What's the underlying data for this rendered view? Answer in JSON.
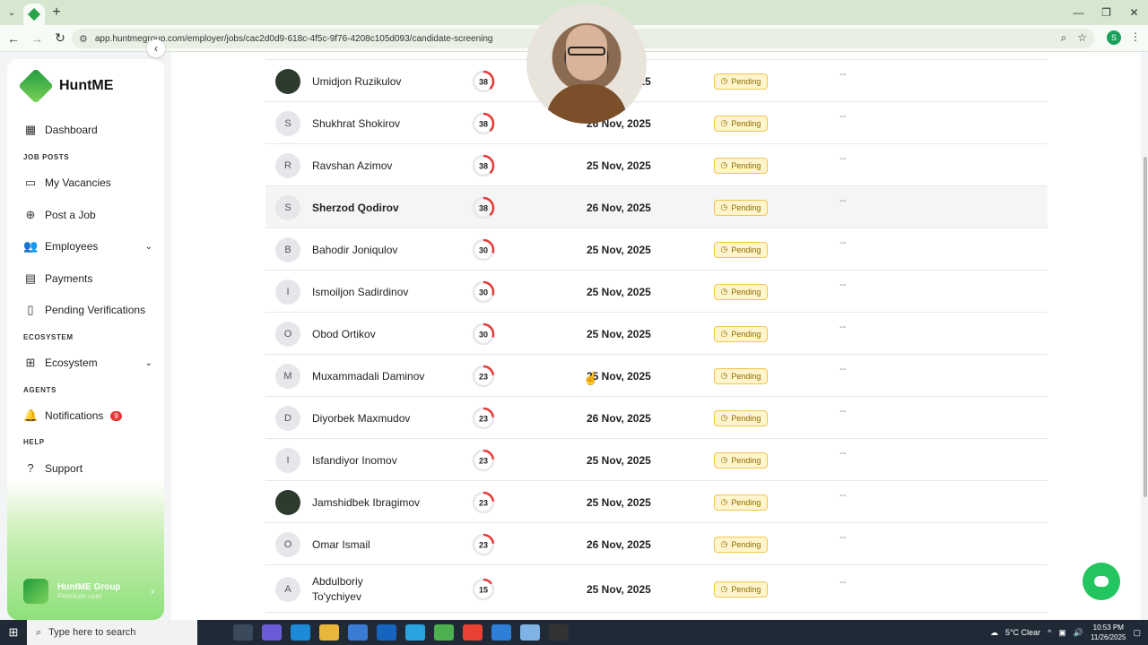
{
  "browser": {
    "url": "app.huntmegroup.com/employer/jobs/cac2d0d9-618c-4f5c-9f76-4208c105d093/candidate-screening",
    "profile_initial": "S"
  },
  "sidebar": {
    "brand": "HuntME",
    "items": [
      {
        "label": "Dashboard",
        "icon": "grid-icon"
      },
      {
        "label": "My Vacancies",
        "icon": "briefcase-icon"
      },
      {
        "label": "Post a Job",
        "icon": "plus-circle-icon"
      },
      {
        "label": "Employees",
        "icon": "users-icon"
      },
      {
        "label": "Payments",
        "icon": "wallet-icon"
      },
      {
        "label": "Pending Verifications",
        "icon": "document-icon"
      },
      {
        "label": "Ecosystem",
        "icon": "table-icon"
      },
      {
        "label": "Notifications",
        "icon": "bell-icon",
        "badge": "9"
      },
      {
        "label": "Support",
        "icon": "help-circle-icon"
      }
    ],
    "sections": {
      "job_posts": "JOB POSTS",
      "ecosystem": "ECOSYSTEM",
      "agents": "AGENTS",
      "help": "HELP"
    },
    "user": {
      "name": "HuntME Group",
      "plan": "Premium user"
    }
  },
  "candidates": [
    {
      "initial": "",
      "photo": true,
      "name": "Umidjon Ruzikulov",
      "score": 38,
      "date": "25 Nov, 2025",
      "status": "Pending",
      "note": "--"
    },
    {
      "initial": "S",
      "name": "Shukhrat Shokirov",
      "score": 38,
      "date": "26 Nov, 2025",
      "status": "Pending",
      "note": "--"
    },
    {
      "initial": "R",
      "name": "Ravshan Azimov",
      "score": 38,
      "date": "25 Nov, 2025",
      "status": "Pending",
      "note": "--"
    },
    {
      "initial": "S",
      "name": "Sherzod Qodirov",
      "score": 38,
      "date": "26 Nov, 2025",
      "status": "Pending",
      "note": "--",
      "highlight": true
    },
    {
      "initial": "B",
      "name": "Bahodir Joniqulov",
      "score": 30,
      "date": "25 Nov, 2025",
      "status": "Pending",
      "note": "--"
    },
    {
      "initial": "I",
      "name": "Ismoiljon Sadirdinov",
      "score": 30,
      "date": "25 Nov, 2025",
      "status": "Pending",
      "note": "--"
    },
    {
      "initial": "O",
      "name": "Obod Ortikov",
      "score": 30,
      "date": "25 Nov, 2025",
      "status": "Pending",
      "note": "--"
    },
    {
      "initial": "M",
      "name": "Muxammadali Daminov",
      "score": 23,
      "date": "25 Nov, 2025",
      "status": "Pending",
      "note": "--"
    },
    {
      "initial": "D",
      "name": "Diyorbek Maxmudov",
      "score": 23,
      "date": "26 Nov, 2025",
      "status": "Pending",
      "note": "--"
    },
    {
      "initial": "I",
      "name": "Isfandiyor Inomov",
      "score": 23,
      "date": "25 Nov, 2025",
      "status": "Pending",
      "note": "--"
    },
    {
      "initial": "",
      "photo": true,
      "name": "Jamshidbek Ibragimov",
      "score": 23,
      "date": "25 Nov, 2025",
      "status": "Pending",
      "note": "--"
    },
    {
      "initial": "O",
      "name": "Omar Ismail",
      "score": 23,
      "date": "26 Nov, 2025",
      "status": "Pending",
      "note": "--"
    },
    {
      "initial": "A",
      "name": "Abdulboriy To'ychiyev",
      "score": 15,
      "date": "25 Nov, 2025",
      "status": "Pending",
      "note": "--"
    }
  ],
  "score_max": 100,
  "colors": {
    "accent": "#22c55e",
    "score_ring": "#e53935",
    "pending_bg": "#fff4cc"
  },
  "taskbar": {
    "search_placeholder": "Type here to search",
    "weather": "5°C  Clear",
    "time": "10:53 PM",
    "date": "11/26/2025"
  }
}
